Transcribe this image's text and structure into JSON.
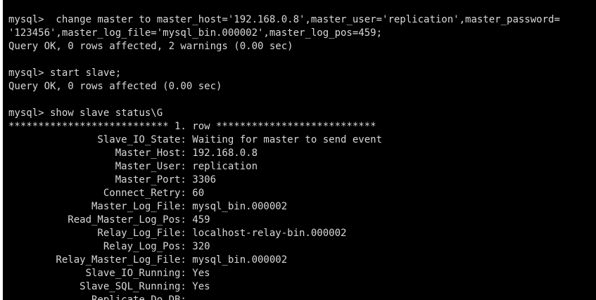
{
  "terminal": {
    "lines": [
      "mysql>  change master to master_host='192.168.0.8',master_user='replication',master_password=",
      "'123456',master_log_file='mysql_bin.000002',master_log_pos=459;",
      "Query OK, 0 rows affected, 2 warnings (0.00 sec)",
      "",
      "mysql> start slave;",
      "Query OK, 0 rows affected (0.00 sec)",
      "",
      "mysql> show slave status\\G",
      "*************************** 1. row ***************************",
      "               Slave_IO_State: Waiting for master to send event",
      "                  Master_Host: 192.168.0.8",
      "                  Master_User: replication",
      "                  Master_Port: 3306",
      "                Connect_Retry: 60",
      "              Master_Log_File: mysql_bin.000002",
      "          Read_Master_Log_Pos: 459",
      "               Relay_Log_File: localhost-relay-bin.000002",
      "                Relay_Log_Pos: 320",
      "        Relay_Master_Log_File: mysql_bin.000002",
      "             Slave_IO_Running: Yes",
      "            Slave_SQL_Running: Yes",
      "              Replicate_Do_DB:"
    ]
  }
}
